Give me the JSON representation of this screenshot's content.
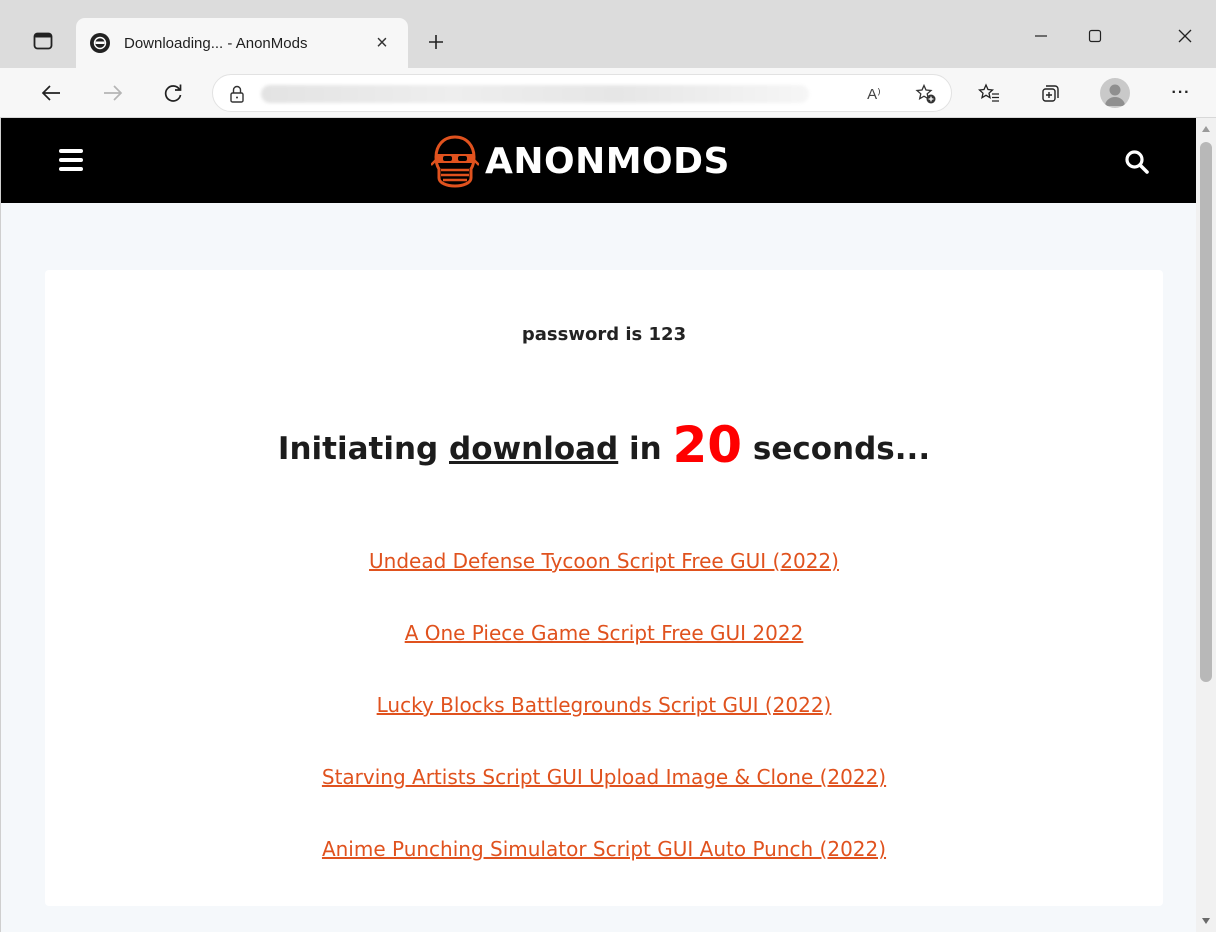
{
  "browser": {
    "tab": {
      "title": "Downloading... - AnonMods",
      "close_glyph": "×"
    },
    "icons": {
      "tab_actions": "tab-actions-icon",
      "new_tab": "plus-icon",
      "minimize": "minimize-icon",
      "maximize": "maximize-icon",
      "close": "close-icon",
      "back": "back-arrow-icon",
      "forward": "forward-arrow-icon",
      "refresh": "refresh-icon",
      "lock": "lock-icon",
      "read_aloud": "read-aloud-icon",
      "add_favorite": "add-favorite-icon",
      "favorites": "favorites-icon",
      "collections": "collections-icon",
      "profile": "profile-avatar",
      "more": "more-icon"
    },
    "read_aloud_glyph": "A⁾",
    "more_glyph": "···"
  },
  "site": {
    "logo_text": "ANONMODS",
    "brand_color": "#e0521e",
    "header_bg": "#000000"
  },
  "content": {
    "password_text": "password is 123",
    "headline_prefix": "Initiating ",
    "headline_link": "download",
    "headline_mid": " in ",
    "countdown": "20",
    "headline_suffix": " seconds...",
    "countdown_color": "#ff0000",
    "links": [
      "Undead Defense Tycoon Script Free GUI (2022)",
      "A One Piece Game Script Free GUI 2022",
      "Lucky Blocks Battlegrounds Script GUI (2022)",
      "Starving Artists Script GUI Upload Image & Clone (2022)",
      "Anime Punching Simulator Script GUI Auto Punch (2022)"
    ]
  }
}
